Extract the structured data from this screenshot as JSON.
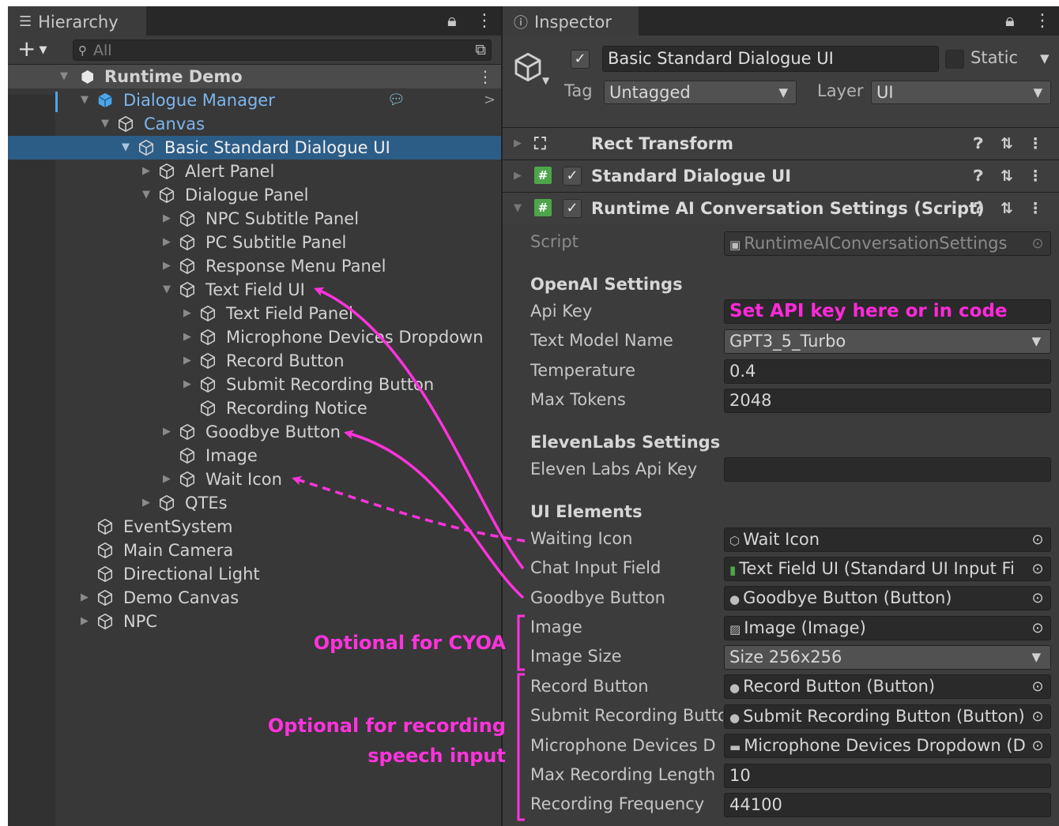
{
  "hierarchy": {
    "tab_label": "Hierarchy",
    "search_placeholder": "All",
    "items": [
      {
        "label": "Runtime Demo"
      },
      {
        "label": "Dialogue Manager"
      },
      {
        "label": "Canvas"
      },
      {
        "label": "Basic Standard Dialogue UI"
      },
      {
        "label": "Alert Panel"
      },
      {
        "label": "Dialogue Panel"
      },
      {
        "label": "NPC Subtitle Panel"
      },
      {
        "label": "PC Subtitle Panel"
      },
      {
        "label": "Response Menu Panel"
      },
      {
        "label": "Text Field UI"
      },
      {
        "label": "Text Field Panel"
      },
      {
        "label": "Microphone Devices Dropdown"
      },
      {
        "label": "Record Button"
      },
      {
        "label": "Submit Recording Button"
      },
      {
        "label": "Recording Notice"
      },
      {
        "label": "Goodbye Button"
      },
      {
        "label": "Image"
      },
      {
        "label": "Wait Icon"
      },
      {
        "label": "QTEs"
      },
      {
        "label": "EventSystem"
      },
      {
        "label": "Main Camera"
      },
      {
        "label": "Directional Light"
      },
      {
        "label": "Demo Canvas"
      },
      {
        "label": "NPC"
      }
    ]
  },
  "inspector": {
    "tab_label": "Inspector",
    "object_name": "Basic Standard Dialogue UI",
    "static_label": "Static",
    "tag_label": "Tag",
    "tag_value": "Untagged",
    "layer_label": "Layer",
    "layer_value": "UI",
    "components": [
      {
        "title": "Rect Transform"
      },
      {
        "title": "Standard Dialogue UI"
      },
      {
        "title": "Runtime AI Conversation Settings (Script)"
      }
    ],
    "script_label": "Script",
    "script_value": "RuntimeAIConversationSettings",
    "openai_header": "OpenAI Settings",
    "api_key_label": "Api Key",
    "api_key_value": "Set API key here or in code",
    "text_model_label": "Text Model Name",
    "text_model_value": "GPT3_5_Turbo",
    "temperature_label": "Temperature",
    "temperature_value": "0.4",
    "max_tokens_label": "Max Tokens",
    "max_tokens_value": "2048",
    "elevenlabs_header": "ElevenLabs Settings",
    "eleven_key_label": "Eleven Labs Api Key",
    "eleven_key_value": "",
    "ui_header": "UI Elements",
    "waiting_icon_label": "Waiting Icon",
    "waiting_icon_value": "Wait Icon",
    "chat_input_label": "Chat Input Field",
    "chat_input_value": "Text Field UI (Standard UI Input Fi",
    "goodbye_label": "Goodbye Button",
    "goodbye_value": "Goodbye Button (Button)",
    "image_label": "Image",
    "image_value": "Image (Image)",
    "image_size_label": "Image Size",
    "image_size_value": "Size 256x256",
    "record_label": "Record Button",
    "record_value": "Record Button (Button)",
    "submit_label": "Submit Recording Butto",
    "submit_value": "Submit Recording Button (Button)",
    "mic_label": "Microphone Devices D",
    "mic_value": "Microphone Devices Dropdown (D",
    "max_rec_label": "Max Recording Length",
    "max_rec_value": "10",
    "rec_freq_label": "Recording Frequency",
    "rec_freq_value": "44100"
  },
  "annotations": {
    "cyoa": "Optional for CYOA",
    "recording_line1": "Optional for recording",
    "recording_line2": "speech input",
    "color": "#ff33dc"
  },
  "colors": {
    "selection": "#2c5d87",
    "prefab_blue": "#7cb6ee",
    "script_icon": "#4ea54a"
  }
}
